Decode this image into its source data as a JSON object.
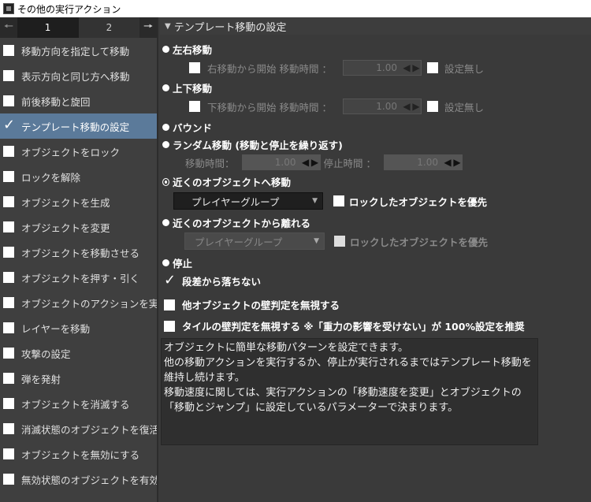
{
  "window": {
    "title": "その他の実行アクション"
  },
  "sidebar": {
    "pages": [
      "1",
      "2"
    ],
    "items": [
      {
        "label": "移動方向を指定して移動",
        "checked": false
      },
      {
        "label": "表示方向と同じ方へ移動",
        "checked": false
      },
      {
        "label": "前後移動と旋回",
        "checked": false
      },
      {
        "label": "テンプレート移動の設定",
        "checked": true
      },
      {
        "label": "オブジェクトをロック",
        "checked": false
      },
      {
        "label": "ロックを解除",
        "checked": false
      },
      {
        "label": "オブジェクトを生成",
        "checked": false
      },
      {
        "label": "オブジェクトを変更",
        "checked": false
      },
      {
        "label": "オブジェクトを移動させる",
        "checked": false
      },
      {
        "label": "オブジェクトを押す・引く",
        "checked": false
      },
      {
        "label": "オブジェクトのアクションを実",
        "checked": false
      },
      {
        "label": "レイヤーを移動",
        "checked": false
      },
      {
        "label": "攻撃の設定",
        "checked": false
      },
      {
        "label": "弾を発射",
        "checked": false
      },
      {
        "label": "オブジェクトを消滅する",
        "checked": false
      },
      {
        "label": "消滅状態のオブジェクトを復活",
        "checked": false
      },
      {
        "label": "オブジェクトを無効にする",
        "checked": false
      },
      {
        "label": "無効状態のオブジェクトを有効",
        "checked": false
      }
    ]
  },
  "main": {
    "header": "テンプレート移動の設定",
    "lr": {
      "label": "左右移動",
      "start_label": "右移動から開始",
      "time_label": "移動時間 ：",
      "time_value": "1.00",
      "none_label": "設定無し"
    },
    "ud": {
      "label": "上下移動",
      "start_label": "下移動から開始",
      "time_label": "移動時間 ：",
      "time_value": "1.00",
      "none_label": "設定無し"
    },
    "bound": {
      "label": "バウンド"
    },
    "random": {
      "label": "ランダム移動 (移動と停止を繰り返す)",
      "move_label": "移動時間：",
      "move_value": "1.00",
      "stop_label": "停止時間 ：",
      "stop_value": "1.00"
    },
    "approach": {
      "label": "近くのオブジェクトへ移動",
      "group": "プレイヤーグループ",
      "priority_label": "ロックしたオブジェクトを優先"
    },
    "away": {
      "label": "近くのオブジェクトから離れる",
      "group": "プレイヤーグループ",
      "priority_label": "ロックしたオブジェクトを優先"
    },
    "stop": {
      "label": "停止"
    },
    "no_fall": {
      "label": "段差から落ちない",
      "checked": true
    },
    "ignore_wall": {
      "label": "他オブジェクトの壁判定を無視する",
      "checked": false
    },
    "ignore_tile": {
      "label": "タイルの壁判定を無視する ※「重力の影響を受けない」が 100%設定を推奨",
      "checked": false
    },
    "description": [
      "オブジェクトに簡単な移動パターンを設定できます。",
      "他の移動アクションを実行するか、停止が実行されるまではテンプレート移動を維持し続けます。",
      "移動速度に関しては、実行アクションの「移動速度を変更」とオブジェクトの「移動とジャンプ」に設定しているパラメーターで決まります。"
    ]
  }
}
